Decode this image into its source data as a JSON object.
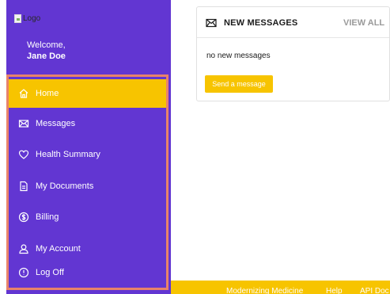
{
  "sidebar": {
    "logo_alt": "Logo",
    "welcome_line": "Welcome,",
    "user_name": "Jane Doe",
    "items": [
      {
        "label": "Home",
        "icon": "home-icon",
        "active": true
      },
      {
        "label": "Messages",
        "icon": "envelope-icon",
        "active": false
      },
      {
        "label": "Health Summary",
        "icon": "heart-icon",
        "active": false
      },
      {
        "label": "My Documents",
        "icon": "document-icon",
        "active": false
      },
      {
        "label": "Billing",
        "icon": "dollar-circle-icon",
        "active": false
      },
      {
        "label": "My Account",
        "icon": "user-icon",
        "active": false
      },
      {
        "label": "Log Off",
        "icon": "power-icon",
        "active": false
      }
    ]
  },
  "messages_panel": {
    "title": "NEW MESSAGES",
    "view_all": "VIEW ALL",
    "empty_text": "no new messages",
    "send_button": "Send a message"
  },
  "footer": {
    "links": [
      "Modernizing Medicine",
      "Help",
      "API Doc"
    ]
  },
  "colors": {
    "sidebar_bg": "#6236d2",
    "accent_yellow": "#f7c400",
    "highlight_border": "#e8836a",
    "view_all_gray": "#9a9a9a"
  }
}
